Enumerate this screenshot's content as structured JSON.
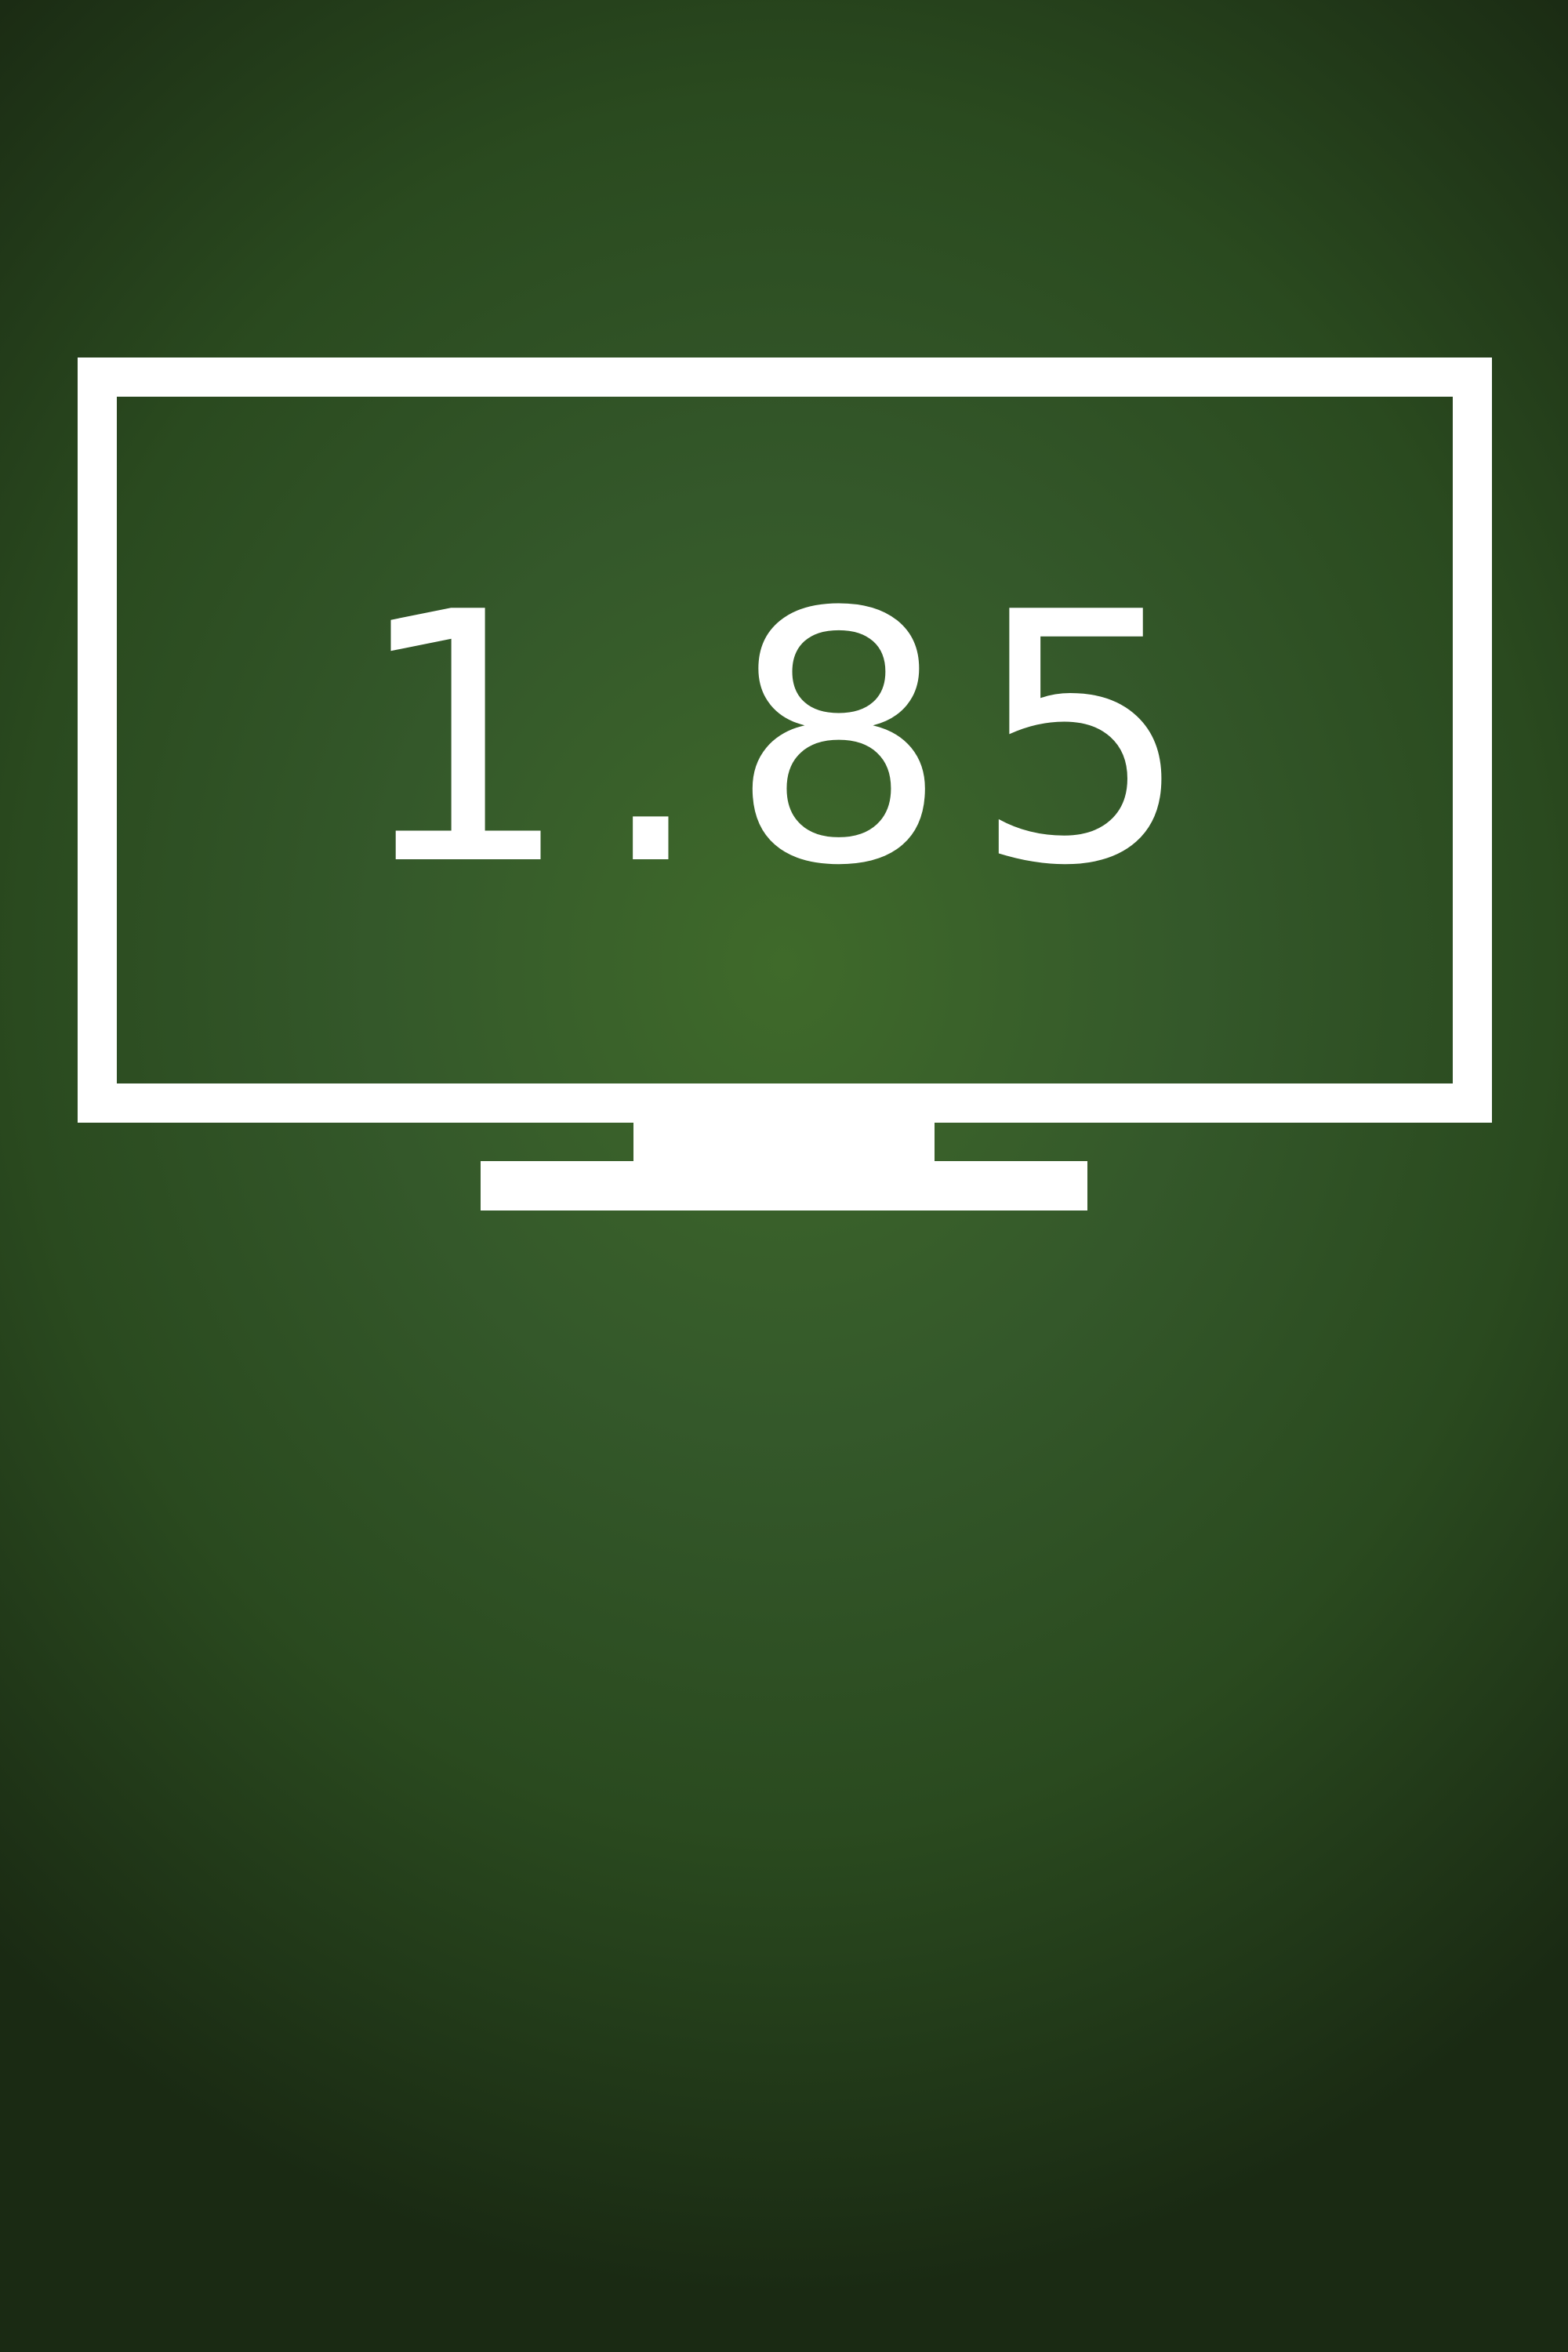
{
  "display": {
    "value": "1.85"
  },
  "icon": "monitor-icon",
  "colors": {
    "background_center": "#3f6a2a",
    "background_edge": "#1a2a13",
    "foreground": "#ffffff"
  }
}
